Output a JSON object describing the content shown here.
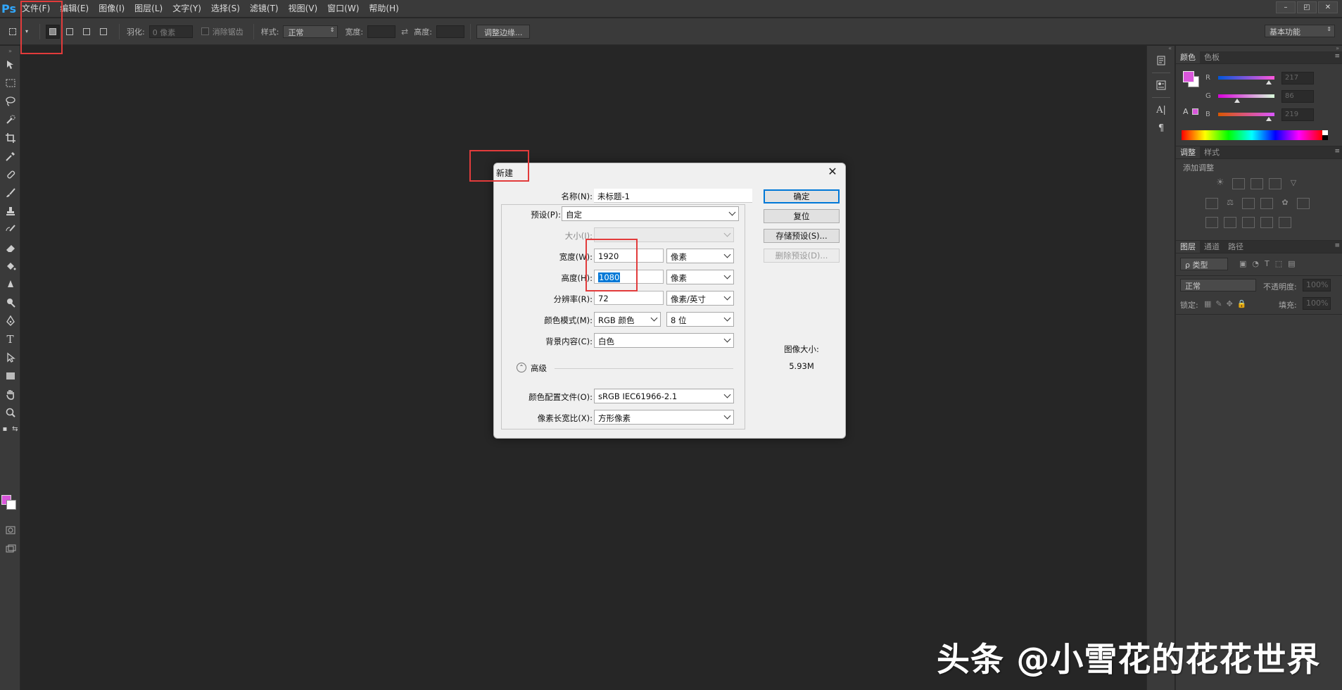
{
  "app": {
    "logo": "Ps"
  },
  "menubar": {
    "items": [
      "文件(F)",
      "编辑(E)",
      "图像(I)",
      "图层(L)",
      "文字(Y)",
      "选择(S)",
      "滤镜(T)",
      "视图(V)",
      "窗口(W)",
      "帮助(H)"
    ],
    "window_controls": [
      "–",
      "◰",
      "✕"
    ]
  },
  "options_bar": {
    "feather_label": "羽化:",
    "feather_value": "0 像素",
    "antialias_label": "消除锯齿",
    "style_label": "样式:",
    "style_value": "正常",
    "width_label": "宽度:",
    "height_label": "高度:",
    "refine_edge_button": "调整边缘...",
    "workspace": "基本功能"
  },
  "colors": {
    "foreground": "#d956db",
    "background": "#ffffff",
    "accent": "#31a8ff",
    "highlight": "#e23b3b"
  },
  "panels": {
    "color": {
      "tabs": [
        "颜色",
        "色板"
      ],
      "r_label": "R",
      "g_label": "G",
      "b_label": "B",
      "r_value": "217",
      "g_value": "86",
      "b_value": "219"
    },
    "adjustments": {
      "tabs": [
        "调整",
        "样式"
      ],
      "add_label": "添加调整"
    },
    "layers": {
      "tabs": [
        "图层",
        "通道",
        "路径"
      ],
      "kind_filter": "ρ 类型",
      "blend_mode": "正常",
      "opacity_label": "不透明度:",
      "opacity_value": "100%",
      "lock_label": "锁定:",
      "fill_label": "填充:",
      "fill_value": "100%"
    }
  },
  "dialog": {
    "title": "新建",
    "close": "✕",
    "name_label": "名称(N):",
    "name_value": "未标题-1",
    "preset_label": "预设(P):",
    "preset_value": "自定",
    "size_label": "大小(I):",
    "width_label": "宽度(W):",
    "width_value": "1920",
    "width_unit": "像素",
    "height_label": "高度(H):",
    "height_value": "1080",
    "height_unit": "像素",
    "resolution_label": "分辨率(R):",
    "resolution_value": "72",
    "resolution_unit": "像素/英寸",
    "color_mode_label": "颜色模式(M):",
    "color_mode_value": "RGB 颜色",
    "bit_depth_value": "8 位",
    "background_label": "背景内容(C):",
    "background_value": "白色",
    "advanced_label": "高级",
    "color_profile_label": "颜色配置文件(O):",
    "color_profile_value": "sRGB IEC61966-2.1",
    "pixel_aspect_label": "像素长宽比(X):",
    "pixel_aspect_value": "方形像素",
    "ok_button": "确定",
    "reset_button": "复位",
    "save_preset_button": "存储预设(S)...",
    "delete_preset_button": "删除预设(D)...",
    "image_size_label": "图像大小:",
    "image_size_value": "5.93M"
  },
  "watermark": "头条 @小雪花的花花世界"
}
